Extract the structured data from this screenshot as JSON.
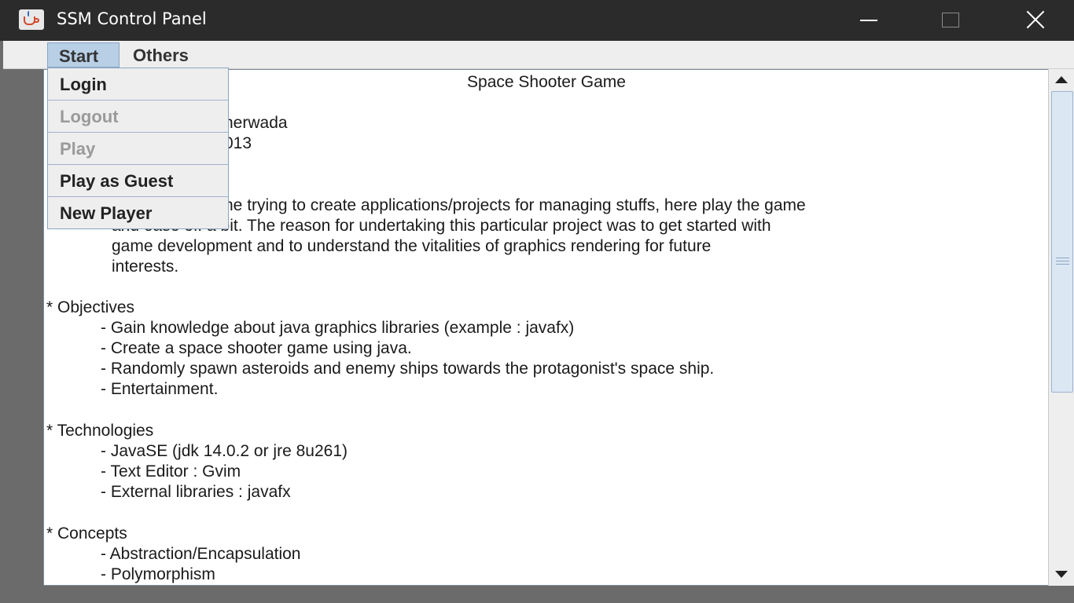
{
  "window": {
    "title": "SSM Control Panel",
    "icon": "java-cup-icon"
  },
  "menubar": {
    "items": [
      {
        "label": "Start",
        "active": true
      },
      {
        "label": "Others",
        "active": false
      }
    ]
  },
  "dropdown": {
    "items": [
      {
        "label": "Login",
        "enabled": true
      },
      {
        "label": "Logout",
        "enabled": false
      },
      {
        "label": "Play",
        "enabled": false
      },
      {
        "label": "Play as Guest",
        "enabled": true
      },
      {
        "label": "New Player",
        "enabled": true
      }
    ]
  },
  "content": {
    "title": "Space Shooter Game",
    "author_fragment": "herwada",
    "year_fragment": "013",
    "intro_fragment": "ne trying to create applications/projects for managing stuffs, here play the game",
    "intro_line2_fragment": "and ease off a bit. The reason for undertaking this particular project was to get started with",
    "intro_line3": "game development and to understand the vitalities of graphics rendering for future",
    "intro_line4": "interests.",
    "sections": [
      {
        "heading": "* Objectives",
        "items": [
          "- Gain knowledge about java graphics libraries (example : javafx)",
          "- Create a space shooter game using java.",
          "- Randomly spawn asteroids and enemy ships towards the protagonist's space ship.",
          "- Entertainment."
        ]
      },
      {
        "heading": "* Technologies",
        "items": [
          "- JavaSE (jdk 14.0.2 or jre 8u261)",
          "- Text Editor : Gvim",
          "- External libraries : javafx"
        ]
      },
      {
        "heading": "* Concepts",
        "items": [
          "- Abstraction/Encapsulation",
          "- Polymorphism"
        ]
      }
    ]
  },
  "colors": {
    "titlebar": "#2b2b2b",
    "menu_highlight": "#b8cfe5",
    "disabled_text": "#9a9a9a"
  }
}
